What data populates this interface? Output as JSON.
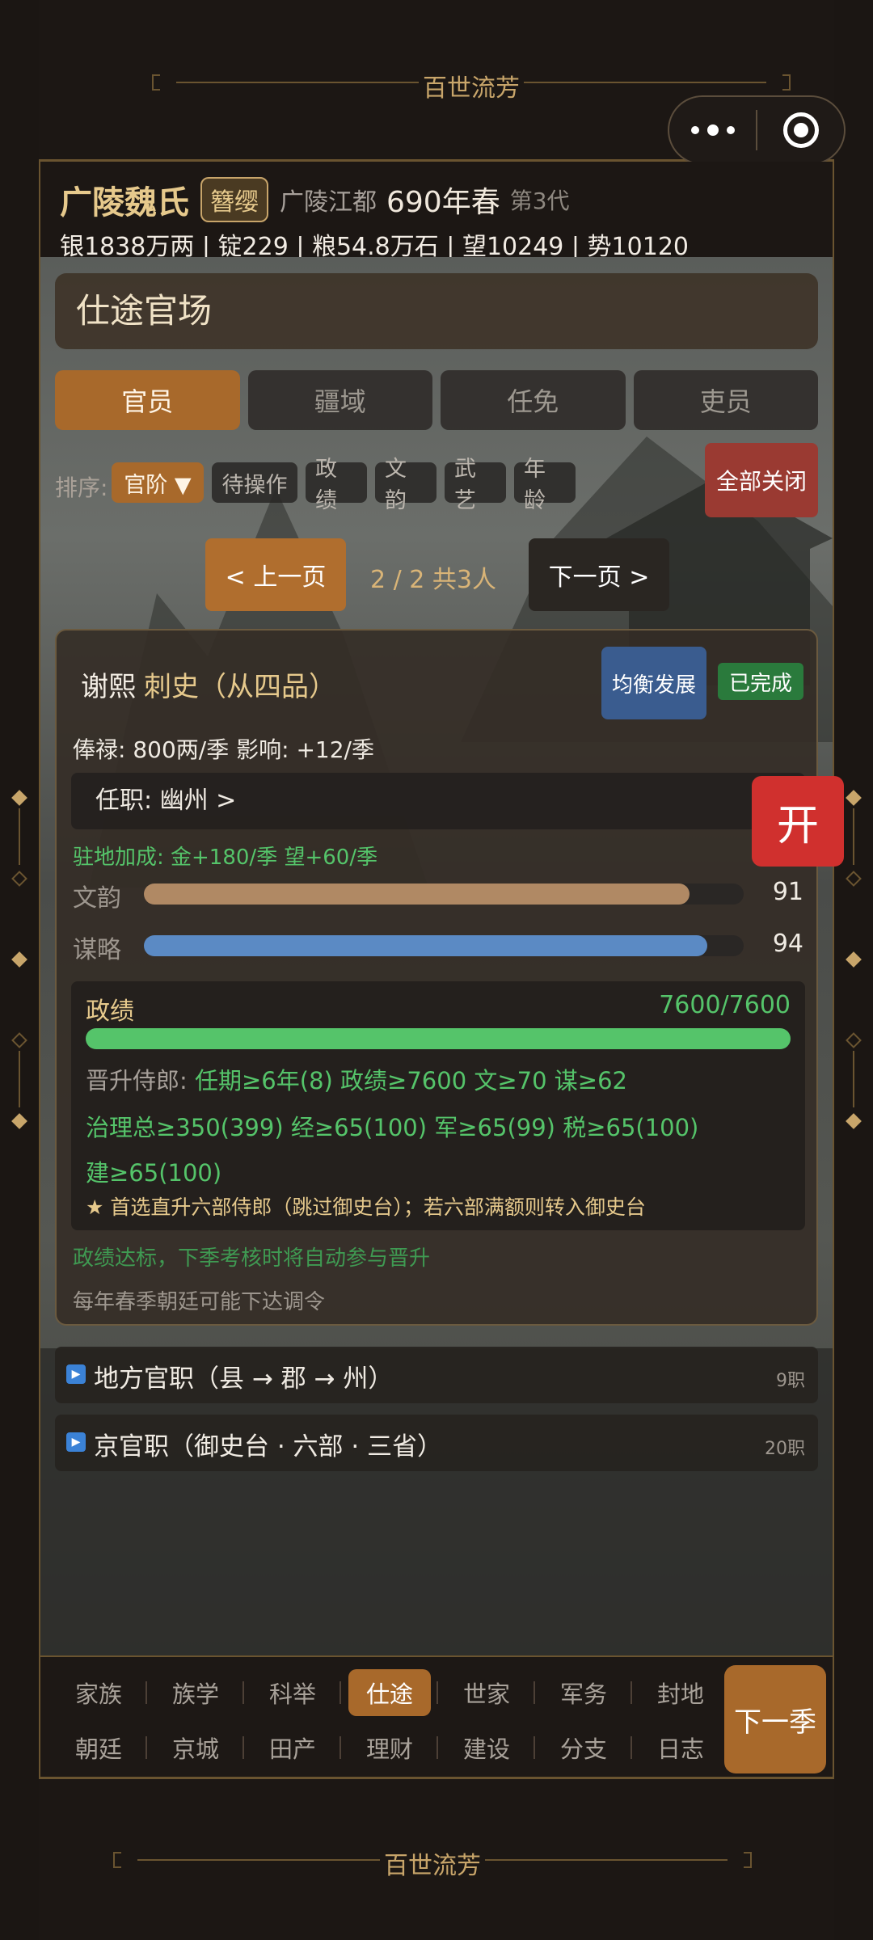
{
  "deco_title": "百世流芳",
  "header": {
    "clan_name": "广陵魏氏",
    "badge": "簪缨",
    "place": "广陵江都",
    "year": "690年春",
    "generation": "第3代",
    "resources": "银1838万两 | 锭229 | 粮54.8万石 | 望10249 | 势10120"
  },
  "panel": {
    "title": "仕途官场"
  },
  "tabs": [
    {
      "label": "官员",
      "active": true
    },
    {
      "label": "疆域",
      "active": false
    },
    {
      "label": "任免",
      "active": false
    },
    {
      "label": "吏员",
      "active": false
    }
  ],
  "sort": {
    "label": "排序:",
    "options": [
      "官阶 ▼",
      "待操作",
      "政绩",
      "文韵",
      "武艺",
      "年龄"
    ],
    "active": "官阶 ▼",
    "close_all": "全部关闭"
  },
  "pager": {
    "prev": "< 上一页",
    "info": "2 / 2  共3人",
    "next": "下一页 >"
  },
  "official": {
    "name": "谢熙",
    "rank": "刺史（从四品）",
    "focus_button": "均衡发展",
    "status": "已完成",
    "salary": "俸禄: 800两/季   影响: +12/季",
    "post": "任职: 幽州  >",
    "bonus": "驻地加成: 金+180/季  望+60/季",
    "stats": [
      {
        "label": "文韵",
        "value": 91,
        "max": 100,
        "color": "#b08964"
      },
      {
        "label": "谋略",
        "value": 94,
        "max": 100,
        "color": "#5b8ac4"
      }
    ],
    "performance": {
      "label": "政绩",
      "value": "7600/7600",
      "ratio": 1.0,
      "promo_key": "晋升侍郎:",
      "promo_req": " 任期≥6年(8)  政绩≥7600  文≥70  谋≥62",
      "req_line2": "治理总≥350(399)  经≥65(100)  军≥65(99)  税≥65(100)",
      "req_line3": "建≥65(100)",
      "star_note": "★ 首选直升六部侍郎（跳过御史台）；若六部满额则转入御史台"
    },
    "note_green": "政绩达标，下季考核时将自动参与晋升",
    "note_gray": "每年春季朝廷可能下达调令"
  },
  "open_button": "开",
  "sections": [
    {
      "icon": "play-icon",
      "title": "地方官职（县 → 郡 → 州）",
      "count": "9职"
    },
    {
      "icon": "play-icon",
      "title": "京官职（御史台 · 六部 · 三省）",
      "count": "20职"
    }
  ],
  "nav": {
    "row1": [
      "家族",
      "族学",
      "科举",
      "仕途",
      "世家",
      "军务",
      "封地"
    ],
    "row2": [
      "朝廷",
      "京城",
      "田产",
      "理财",
      "建设",
      "分支",
      "日志"
    ],
    "active": "仕途",
    "next_season": "下一季"
  },
  "colors": {
    "accent": "#a8692b",
    "gold": "#e6c98c",
    "green": "#55c46a",
    "red": "#d0302e",
    "blue": "#3a5c8f"
  }
}
